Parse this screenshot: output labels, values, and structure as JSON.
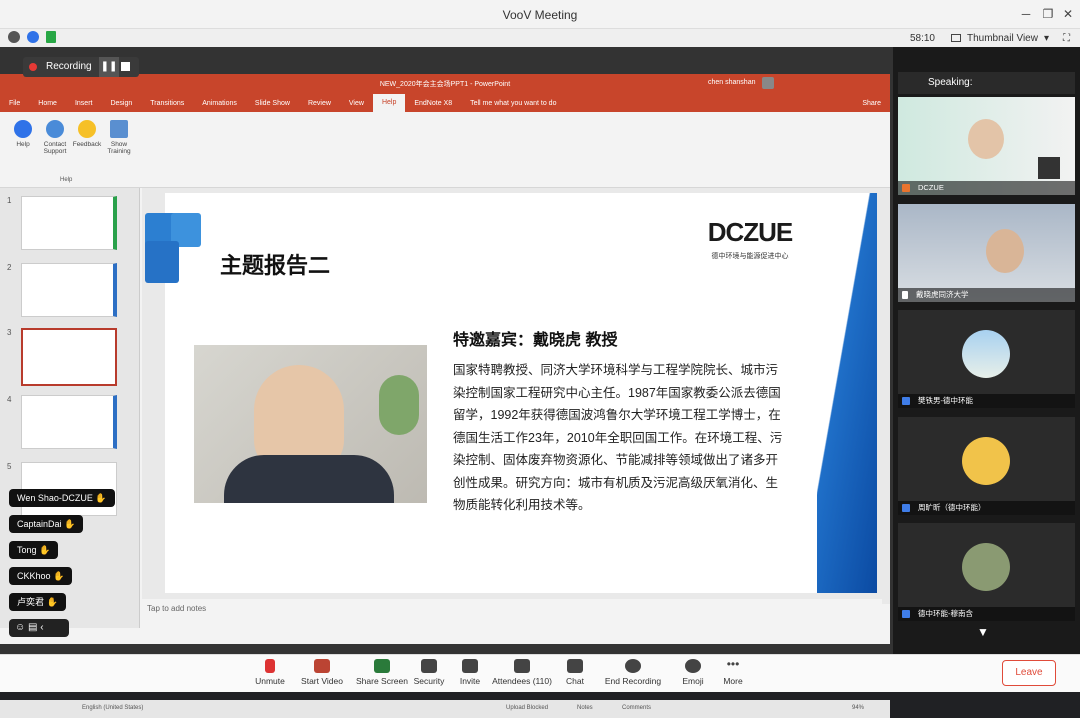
{
  "window": {
    "title": "VooV Meeting"
  },
  "meeting_bar": {
    "timer": "58:10",
    "view_label": "Thumbnail View"
  },
  "recording": {
    "label": "Recording"
  },
  "ppt": {
    "doc_title": "NEW_2020年会主会场PPT1 - PowerPoint",
    "user": "chen shanshan",
    "tabs": [
      "File",
      "Home",
      "Insert",
      "Design",
      "Transitions",
      "Animations",
      "Slide Show",
      "Review",
      "View",
      "Help",
      "EndNote X8"
    ],
    "active_tab": "Help",
    "tell_me": "Tell me what you want to do",
    "share": "Share",
    "ribbon_buttons": [
      {
        "label": "Help"
      },
      {
        "label": "Contact Support"
      },
      {
        "label": "Feedback"
      },
      {
        "label": "Show Training"
      }
    ],
    "ribbon_group": "Help",
    "thumb_numbers": [
      "1",
      "2",
      "3",
      "4",
      "5"
    ],
    "notes_placeholder": "Tap to add notes",
    "status": {
      "lang": "English (United States)",
      "upload": "Upload Blocked",
      "notes": "Notes",
      "comments": "Comments",
      "zoom": "94%"
    }
  },
  "slide": {
    "heading": "主题报告二",
    "logo_main": "DCZUE",
    "logo_sub": "德中环境与能源促进中心",
    "guest": "特邀嘉宾：戴晓虎 教授",
    "bio": "国家特聘教授、同济大学环境科学与工程学院院长、城市污染控制国家工程研究中心主任。1987年国家教委公派去德国留学，1992年获得德国波鸿鲁尔大学环境工程工学博士，在德国生活工作23年，2010年全职回国工作。在环境工程、污染控制、固体废弃物资源化、节能减排等领域做出了诸多开创性成果。研究方向：城市有机质及污泥高级厌氧消化、生物质能转化利用技术等。"
  },
  "sidebar": {
    "speaking_label": "Speaking:",
    "participants": [
      {
        "name": "DCZUE"
      },
      {
        "name": "戴晓虎同济大学"
      },
      {
        "name": "樊铁男-德中环能"
      },
      {
        "name": "周旷昕（德中环能）"
      },
      {
        "name": "德中环能-穆南含"
      }
    ]
  },
  "reactions": [
    "Wen Shao-DCZUE",
    "CaptainDai",
    "Tong",
    "CKKhoo",
    "卢奕君"
  ],
  "controls": [
    {
      "label": "Unmute"
    },
    {
      "label": "Start Video"
    },
    {
      "label": "Share Screen"
    },
    {
      "label": "Security"
    },
    {
      "label": "Invite"
    },
    {
      "label": "Attendees (110)"
    },
    {
      "label": "Chat"
    },
    {
      "label": "End Recording"
    },
    {
      "label": "Emoji"
    },
    {
      "label": "More"
    }
  ],
  "leave_label": "Leave"
}
